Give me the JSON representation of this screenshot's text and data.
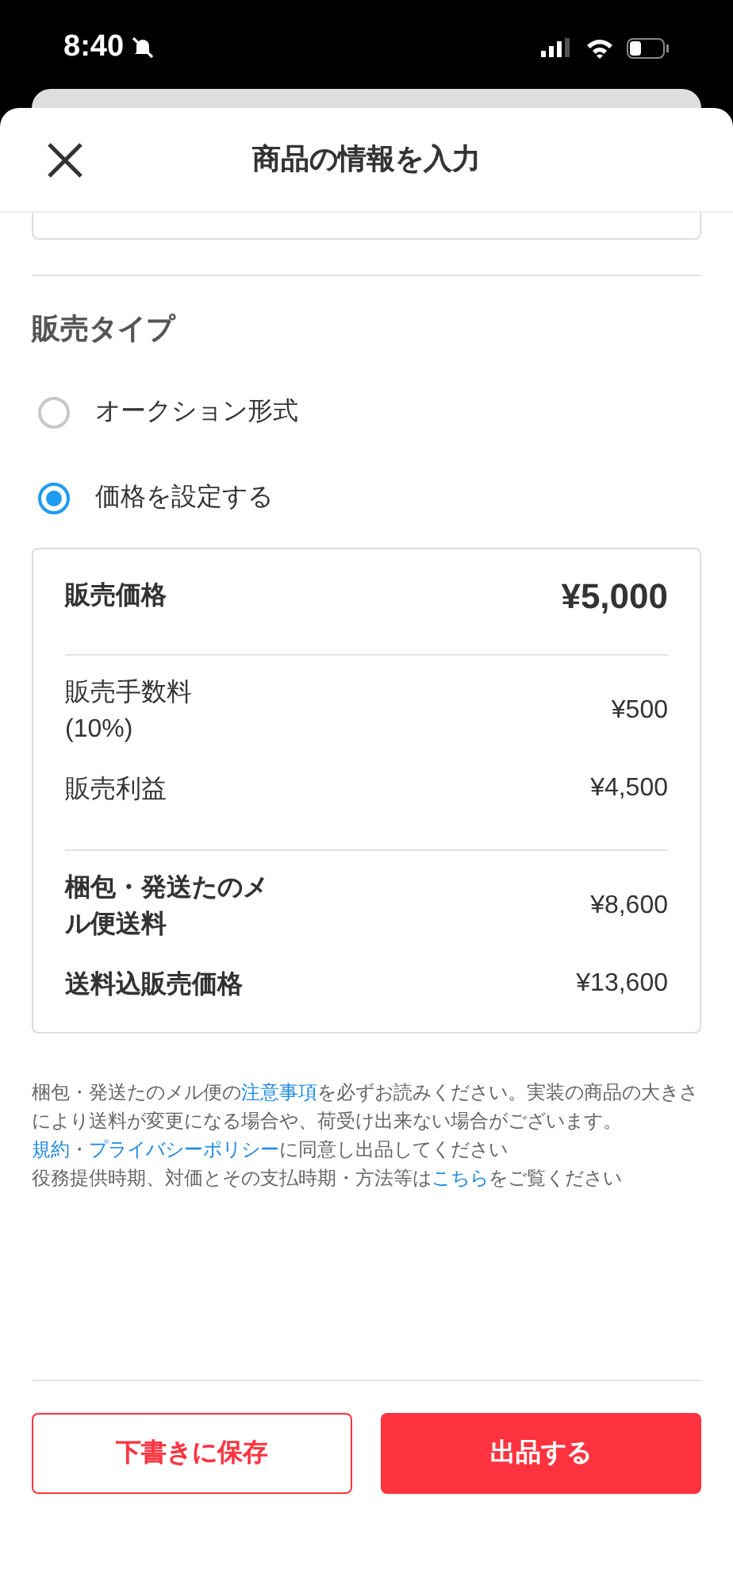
{
  "status_bar": {
    "time": "8:40",
    "silent": true
  },
  "header": {
    "title": "商品の情報を入力"
  },
  "sale_type": {
    "heading": "販売タイプ",
    "options": [
      {
        "label": "オークション形式",
        "selected": false
      },
      {
        "label": "価格を設定する",
        "selected": true
      }
    ]
  },
  "price_card": {
    "rows": [
      {
        "label": "販売価格",
        "value": "¥5,000",
        "kind": "main"
      },
      {
        "label": "販売手数料\n(10%)",
        "value": "¥500",
        "kind": "plain"
      },
      {
        "label": "販売利益",
        "value": "¥4,500",
        "kind": "plain"
      },
      {
        "label": "梱包・発送たのメル便送料",
        "value": "¥8,600",
        "kind": "bold"
      },
      {
        "label": "送料込販売価格",
        "value": "¥13,600",
        "kind": "bold"
      }
    ]
  },
  "notes": [
    [
      {
        "text": "梱包・発送たのメル便の",
        "link": false
      },
      {
        "text": "注意事項",
        "link": true
      },
      {
        "text": "を必ずお読みください。実装の商品の大きさにより送料が変更になる場合や、荷受け出来ない場合がございます。",
        "link": false
      }
    ],
    [
      {
        "text": "規約",
        "link": true
      },
      {
        "text": "・",
        "link": false
      },
      {
        "text": "プライバシーポリシー",
        "link": true
      },
      {
        "text": "に同意し出品してください",
        "link": false
      }
    ],
    [
      {
        "text": "役務提供時期、対価とその支払時期・方法等は",
        "link": false
      },
      {
        "text": "こちら",
        "link": true
      },
      {
        "text": "をご覧ください",
        "link": false
      }
    ]
  ],
  "buttons": [
    {
      "label": "下書きに保存",
      "kind": "outline"
    },
    {
      "label": "出品する",
      "kind": "primary"
    }
  ]
}
